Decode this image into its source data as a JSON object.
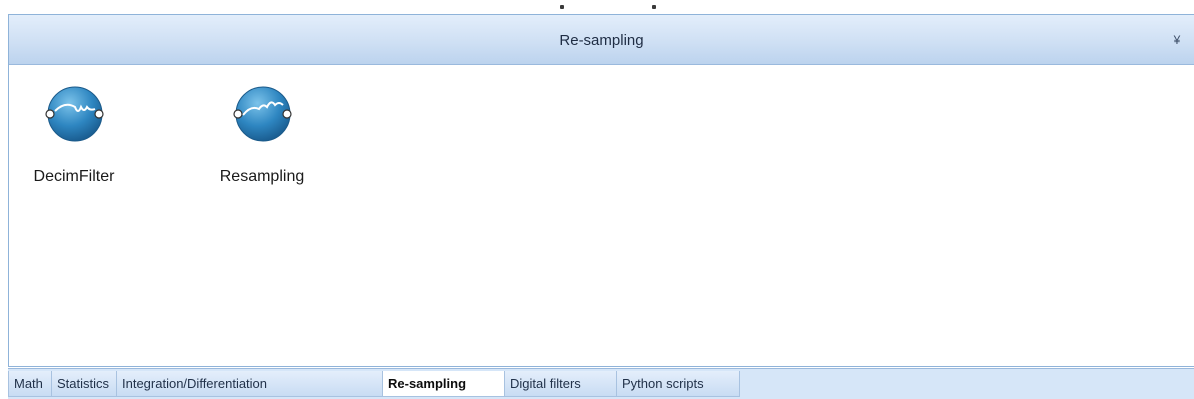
{
  "panel": {
    "title": "Re-sampling",
    "collapse_icon": "double-chevron-down-icon"
  },
  "blocks": [
    {
      "label": "DecimFilter",
      "icon": "decimation-filter-icon"
    },
    {
      "label": "Resampling",
      "icon": "resampling-icon"
    }
  ],
  "tabs": [
    {
      "label": "Math",
      "active": false
    },
    {
      "label": "Statistics",
      "active": false
    },
    {
      "label": "Integration/Differentiation",
      "active": false
    },
    {
      "label": "Re-sampling",
      "active": true
    },
    {
      "label": "Digital filters",
      "active": false
    },
    {
      "label": "Python scripts",
      "active": false
    }
  ],
  "colors": {
    "header_gradient_top": "#e3eefb",
    "header_gradient_bottom": "#bcd3ee",
    "icon_blue": "#2e86c1",
    "tabbar_bg": "#d6e6f8"
  }
}
